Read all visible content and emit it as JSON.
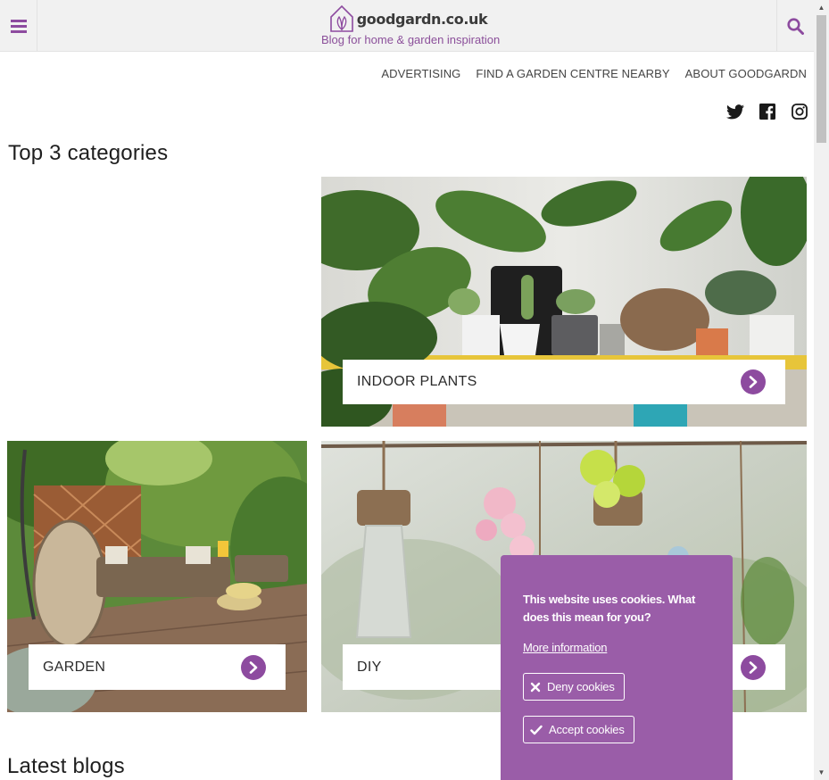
{
  "header": {
    "logo_text": "goodgardn.co.uk",
    "tagline": "Blog for home & garden inspiration"
  },
  "nav": {
    "items": [
      "ADVERTISING",
      "FIND A GARDEN CENTRE NEARBY",
      "ABOUT GOODGARDN"
    ]
  },
  "social": [
    "twitter-icon",
    "facebook-icon",
    "instagram-icon"
  ],
  "sections": {
    "top_title": "Top 3 categories",
    "latest_title": "Latest blogs"
  },
  "categories": [
    {
      "label": "INDOOR PLANTS"
    },
    {
      "label": "GARDEN"
    },
    {
      "label": "DIY"
    }
  ],
  "cookie": {
    "title": "This website uses cookies. What does this mean for you?",
    "more_info": "More information",
    "deny": "Deny cookies",
    "accept": "Accept cookies"
  },
  "colors": {
    "accent": "#8d4b9f",
    "cookie_bg": "#9a5da8",
    "header_bg": "#f1f1f1"
  }
}
